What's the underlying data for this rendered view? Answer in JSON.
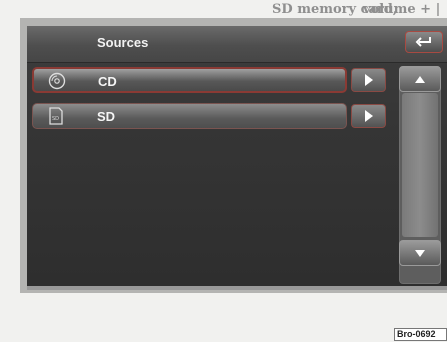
{
  "page": {
    "top_text_left": "SD memory card,",
    "top_text_right": "volume + |",
    "ref_code": "Bro-0692"
  },
  "window": {
    "title": "Sources"
  },
  "sources": [
    {
      "label": "CD",
      "icon": "disc-icon",
      "selected": true
    },
    {
      "label": "SD",
      "icon": "sd-card-icon",
      "selected": false
    }
  ],
  "colors": {
    "selection_border": "#8a3a34",
    "screen_bg": "#353535",
    "text": "#f5f5f5"
  }
}
